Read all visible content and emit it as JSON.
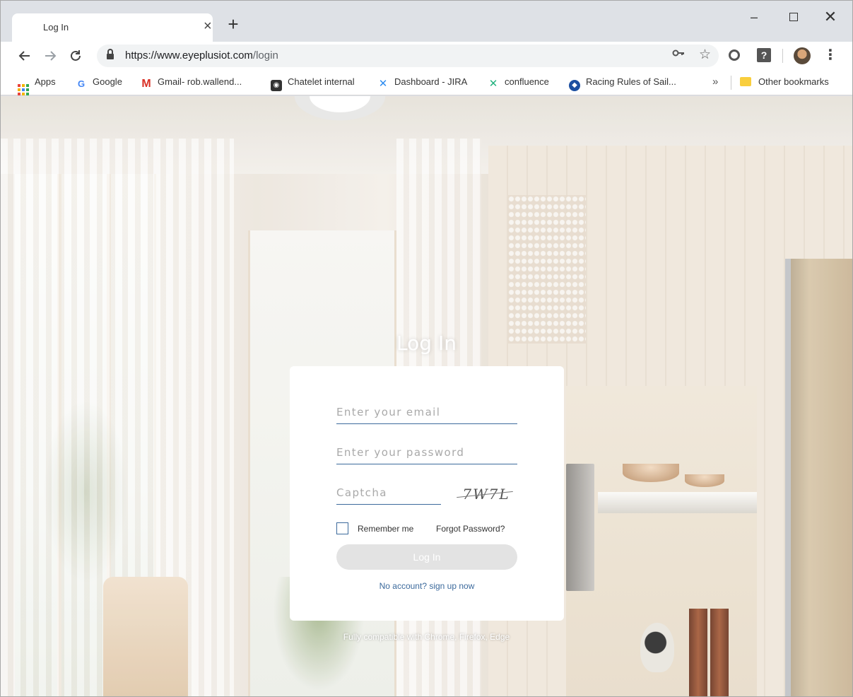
{
  "browser": {
    "tab_title": "Log In",
    "tab_close_glyph": "×",
    "new_tab_glyph": "+",
    "minimize_glyph": "–",
    "close_glyph": "✕",
    "url_host": "https://www.eyeplusiot.com",
    "url_path": "/login",
    "more_bookmarks_glyph": "»",
    "menu_glyph": "⋮"
  },
  "bookmarks": [
    {
      "label": "Apps",
      "icon": "apps-grid-icon"
    },
    {
      "label": "Google",
      "icon": "google-icon",
      "glyph": "G"
    },
    {
      "label": "Gmail- rob.wallend...",
      "icon": "gmail-icon",
      "glyph": "M"
    },
    {
      "label": "Chatelet internal",
      "icon": "camera-icon",
      "glyph": "◉"
    },
    {
      "label": "Dashboard - JIRA",
      "icon": "jira-icon",
      "glyph": "✕"
    },
    {
      "label": "confluence",
      "icon": "confluence-icon",
      "glyph": "✕"
    },
    {
      "label": "Racing Rules of Sail...",
      "icon": "racing-rules-icon",
      "glyph": "◆"
    }
  ],
  "other_bookmarks": "Other bookmarks",
  "login": {
    "title": "Log In",
    "email_placeholder": "Enter your email",
    "password_placeholder": "Enter your password",
    "captcha_placeholder": "Captcha",
    "captcha_text": "7W7L",
    "remember_label": "Remember me",
    "forgot_label": "Forgot Password?",
    "login_button": "Log In",
    "signup_link": "No account?  sign up now",
    "compat_note": "Fully compatible with Chrome, Firefox, Edge"
  },
  "colors": {
    "accent": "#3c6a9c",
    "button_disabled": "#e3e3e3"
  }
}
